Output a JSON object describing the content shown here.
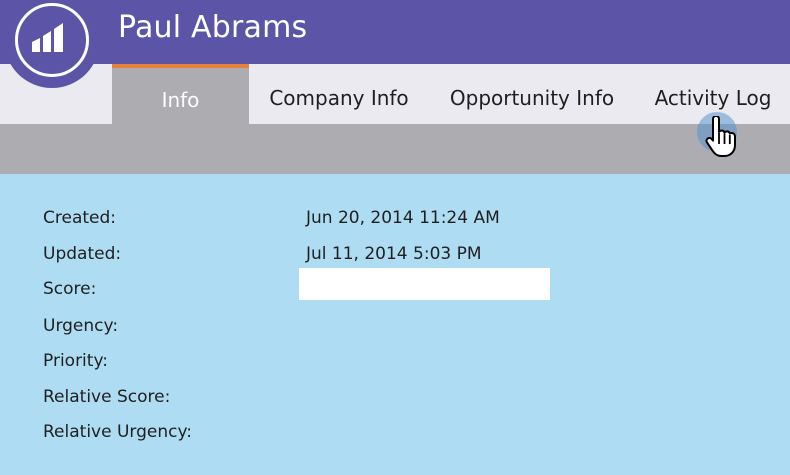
{
  "header": {
    "person_name": "Paul Abrams",
    "logo_icon": "marketo-bars-icon",
    "background_color": "#5c55a7"
  },
  "tabs": [
    {
      "label": "Info",
      "active": true
    },
    {
      "label": "Company Info",
      "active": false
    },
    {
      "label": "Opportunity Info",
      "active": false
    },
    {
      "label": "Activity Log",
      "active": false
    }
  ],
  "accent_color": "#e6813a",
  "details": {
    "created_label": "Created:",
    "created_value": "Jun 20, 2014 11:24 AM",
    "updated_label": "Updated:",
    "updated_value": "Jul 11, 2014 5:03 PM",
    "score_label": "Score:",
    "score_value": "",
    "urgency_label": "Urgency:",
    "priority_label": "Priority:",
    "relative_score_label": "Relative Score:",
    "relative_urgency_label": "Relative Urgency:"
  },
  "cursor": {
    "icon": "hand-pointer-icon"
  }
}
